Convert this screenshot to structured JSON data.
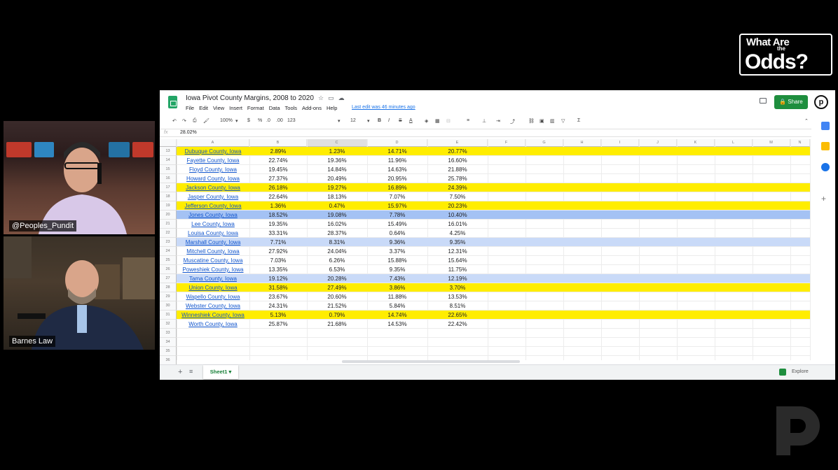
{
  "logo": {
    "line1": "What Are",
    "line2": "the",
    "line3": "Odds?"
  },
  "cams": [
    {
      "label": "@Peoples_Pundit"
    },
    {
      "label": "Barnes Law"
    }
  ],
  "doc": {
    "title": "Iowa Pivot County Margins, 2008 to 2020",
    "menus": [
      "File",
      "Edit",
      "View",
      "Insert",
      "Format",
      "Data",
      "Tools",
      "Add-ons",
      "Help"
    ],
    "last_edit": "Last edit was 46 minutes ago",
    "share_label": "Share",
    "avatar_letter": "p"
  },
  "toolbar": {
    "zoom": "100%",
    "currency": "$",
    "percent": "%",
    "dec_less": ".0",
    "dec_more": ".00",
    "format_more": "123",
    "font_size": "12",
    "bold": "B",
    "italic": "I",
    "strike": "S",
    "text_color": "A"
  },
  "formula_bar": {
    "fx": "fx",
    "value": "28.02%"
  },
  "columns": [
    "A",
    "B",
    "C",
    "D",
    "E",
    "F",
    "G",
    "H",
    "I",
    "J",
    "K",
    "L",
    "M",
    "N"
  ],
  "rows": [
    {
      "num": "13",
      "county": "Dubuque County, Iowa",
      "b": "2.89%",
      "c": "1.23%",
      "d": "14.71%",
      "e": "20.77%",
      "hl": "yellow"
    },
    {
      "num": "14",
      "county": "Fayette County, Iowa",
      "b": "22.74%",
      "c": "19.36%",
      "d": "11.96%",
      "e": "16.60%",
      "hl": ""
    },
    {
      "num": "15",
      "county": "Floyd County, Iowa",
      "b": "19.45%",
      "c": "14.84%",
      "d": "14.63%",
      "e": "21.88%",
      "hl": ""
    },
    {
      "num": "16",
      "county": "Howard County, Iowa",
      "b": "27.37%",
      "c": "20.49%",
      "d": "20.95%",
      "e": "25.78%",
      "hl": ""
    },
    {
      "num": "17",
      "county": "Jackson County, Iowa",
      "b": "26.18%",
      "c": "19.27%",
      "d": "16.89%",
      "e": "24.39%",
      "hl": "yellow"
    },
    {
      "num": "18",
      "county": "Jasper County, Iowa",
      "b": "22.64%",
      "c": "18.13%",
      "d": "7.07%",
      "e": "7.50%",
      "hl": ""
    },
    {
      "num": "19",
      "county": "Jefferson County, Iowa",
      "b": "1.36%",
      "c": "0.47%",
      "d": "15.97%",
      "e": "20.23%",
      "hl": "yellow"
    },
    {
      "num": "20",
      "county": "Jones County, Iowa",
      "b": "18.52%",
      "c": "19.08%",
      "d": "7.78%",
      "e": "10.40%",
      "hl": "blue2"
    },
    {
      "num": "21",
      "county": "Lee County, Iowa",
      "b": "19.35%",
      "c": "16.02%",
      "d": "15.49%",
      "e": "16.01%",
      "hl": ""
    },
    {
      "num": "22",
      "county": "Louisa County, Iowa",
      "b": "33.31%",
      "c": "28.37%",
      "d": "0.64%",
      "e": "4.25%",
      "hl": ""
    },
    {
      "num": "23",
      "county": "Marshall County, Iowa",
      "b": "7.71%",
      "c": "8.31%",
      "d": "9.36%",
      "e": "9.35%",
      "hl": "blue"
    },
    {
      "num": "24",
      "county": "Mitchell County, Iowa",
      "b": "27.92%",
      "c": "24.04%",
      "d": "3.37%",
      "e": "12.31%",
      "hl": ""
    },
    {
      "num": "25",
      "county": "Muscatine County, Iowa",
      "b": "7.03%",
      "c": "6.26%",
      "d": "15.88%",
      "e": "15.64%",
      "hl": ""
    },
    {
      "num": "26",
      "county": "Poweshiek County, Iowa",
      "b": "13.35%",
      "c": "6.53%",
      "d": "9.35%",
      "e": "11.75%",
      "hl": ""
    },
    {
      "num": "27",
      "county": "Tama County, Iowa",
      "b": "19.12%",
      "c": "20.28%",
      "d": "7.43%",
      "e": "12.19%",
      "hl": "blue"
    },
    {
      "num": "28",
      "county": "Union County, Iowa",
      "b": "31.58%",
      "c": "27.49%",
      "d": "3.86%",
      "e": "3.70%",
      "hl": "yellow"
    },
    {
      "num": "29",
      "county": "Wapello County, Iowa",
      "b": "23.67%",
      "c": "20.60%",
      "d": "11.88%",
      "e": "13.53%",
      "hl": ""
    },
    {
      "num": "30",
      "county": "Webster County, Iowa",
      "b": "24.31%",
      "c": "21.52%",
      "d": "5.84%",
      "e": "8.51%",
      "hl": ""
    },
    {
      "num": "31",
      "county": "Winneshiek County, Iowa",
      "b": "5.13%",
      "c": "0.79%",
      "d": "14.74%",
      "e": "22.65%",
      "hl": "yellow"
    },
    {
      "num": "32",
      "county": "Worth County, Iowa",
      "b": "25.87%",
      "c": "21.68%",
      "d": "14.53%",
      "e": "22.42%",
      "hl": ""
    },
    {
      "num": "33",
      "county": "",
      "b": "",
      "c": "",
      "d": "",
      "e": "",
      "hl": ""
    },
    {
      "num": "34",
      "county": "",
      "b": "",
      "c": "",
      "d": "",
      "e": "",
      "hl": ""
    },
    {
      "num": "35",
      "county": "",
      "b": "",
      "c": "",
      "d": "",
      "e": "",
      "hl": ""
    },
    {
      "num": "36",
      "county": "",
      "b": "",
      "c": "",
      "d": "",
      "e": "",
      "hl": ""
    }
  ],
  "sheet_tab": "Sheet1",
  "explore_label": "Explore",
  "colors": {
    "highlight_yellow": "#ffed00",
    "highlight_blue": "#c9daf8",
    "share_green": "#1e8e3e",
    "link_blue": "#1155cc"
  }
}
